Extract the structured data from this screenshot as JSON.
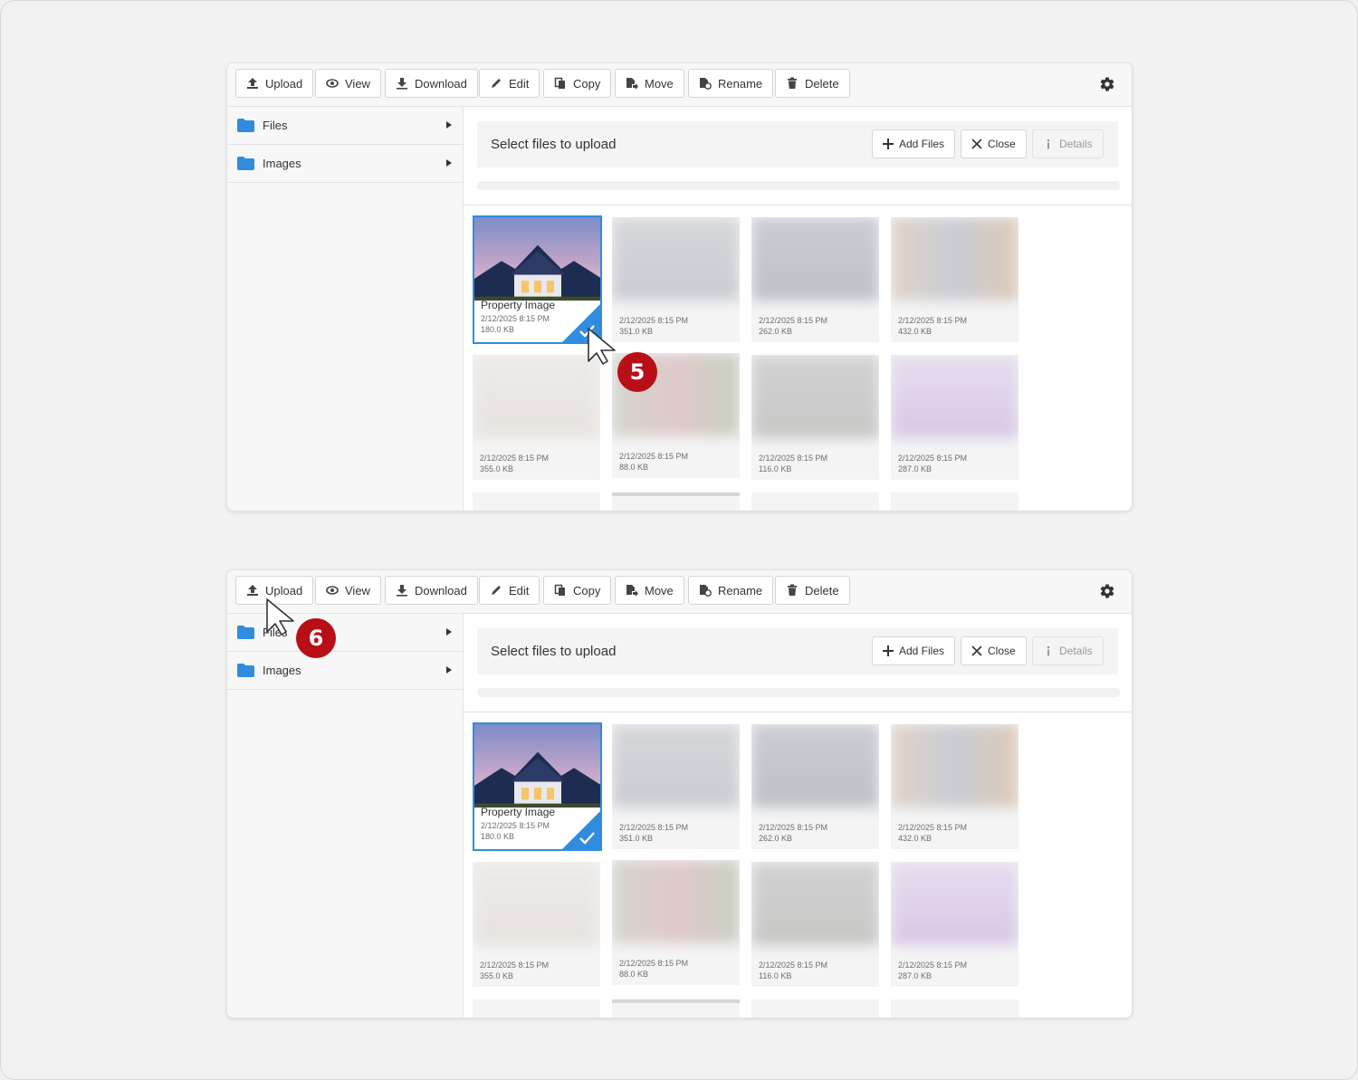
{
  "toolbar": {
    "buttons": [
      {
        "label": "Upload",
        "icon": "upload-icon"
      },
      {
        "label": "View",
        "icon": "eye-icon"
      },
      {
        "label": "Download",
        "icon": "download-icon"
      },
      {
        "label": "Edit",
        "icon": "pencil-icon"
      },
      {
        "label": "Copy",
        "icon": "copy-icon"
      },
      {
        "label": "Move",
        "icon": "move-icon"
      },
      {
        "label": "Rename",
        "icon": "rename-icon"
      },
      {
        "label": "Delete",
        "icon": "trash-icon"
      }
    ],
    "settings_icon": "gear-icon"
  },
  "sidebar": {
    "items": [
      {
        "label": "Files",
        "icon": "folder-icon"
      },
      {
        "label": "Images",
        "icon": "folder-icon"
      }
    ]
  },
  "upload_panel": {
    "title": "Select files to upload",
    "add_files_label": "Add Files",
    "close_label": "Close",
    "details_label": "Details"
  },
  "files": [
    {
      "name": "Property Image",
      "date": "2/12/2025 8:15 PM",
      "size": "180.0 KB",
      "selected": true
    },
    {
      "name": "",
      "date": "2/12/2025 8:15 PM",
      "size": "351.0 KB"
    },
    {
      "name": "",
      "date": "2/12/2025 8:15 PM",
      "size": "262.0 KB"
    },
    {
      "name": "",
      "date": "2/12/2025 8:15 PM",
      "size": "432.0 KB"
    },
    {
      "name": "",
      "date": "2/12/2025 8:15 PM",
      "size": "355.0 KB"
    },
    {
      "name": "",
      "date": "2/12/2025 8:15 PM",
      "size": "88.0 KB"
    },
    {
      "name": "",
      "date": "2/12/2025 8:15 PM",
      "size": "116.0 KB"
    },
    {
      "name": "",
      "date": "2/12/2025 8:15 PM",
      "size": "287.0 KB"
    }
  ],
  "steps": [
    "5",
    "6"
  ],
  "colors": {
    "accent": "#2f8cde",
    "badge": "#b80f16",
    "folder": "#2f8cde"
  }
}
